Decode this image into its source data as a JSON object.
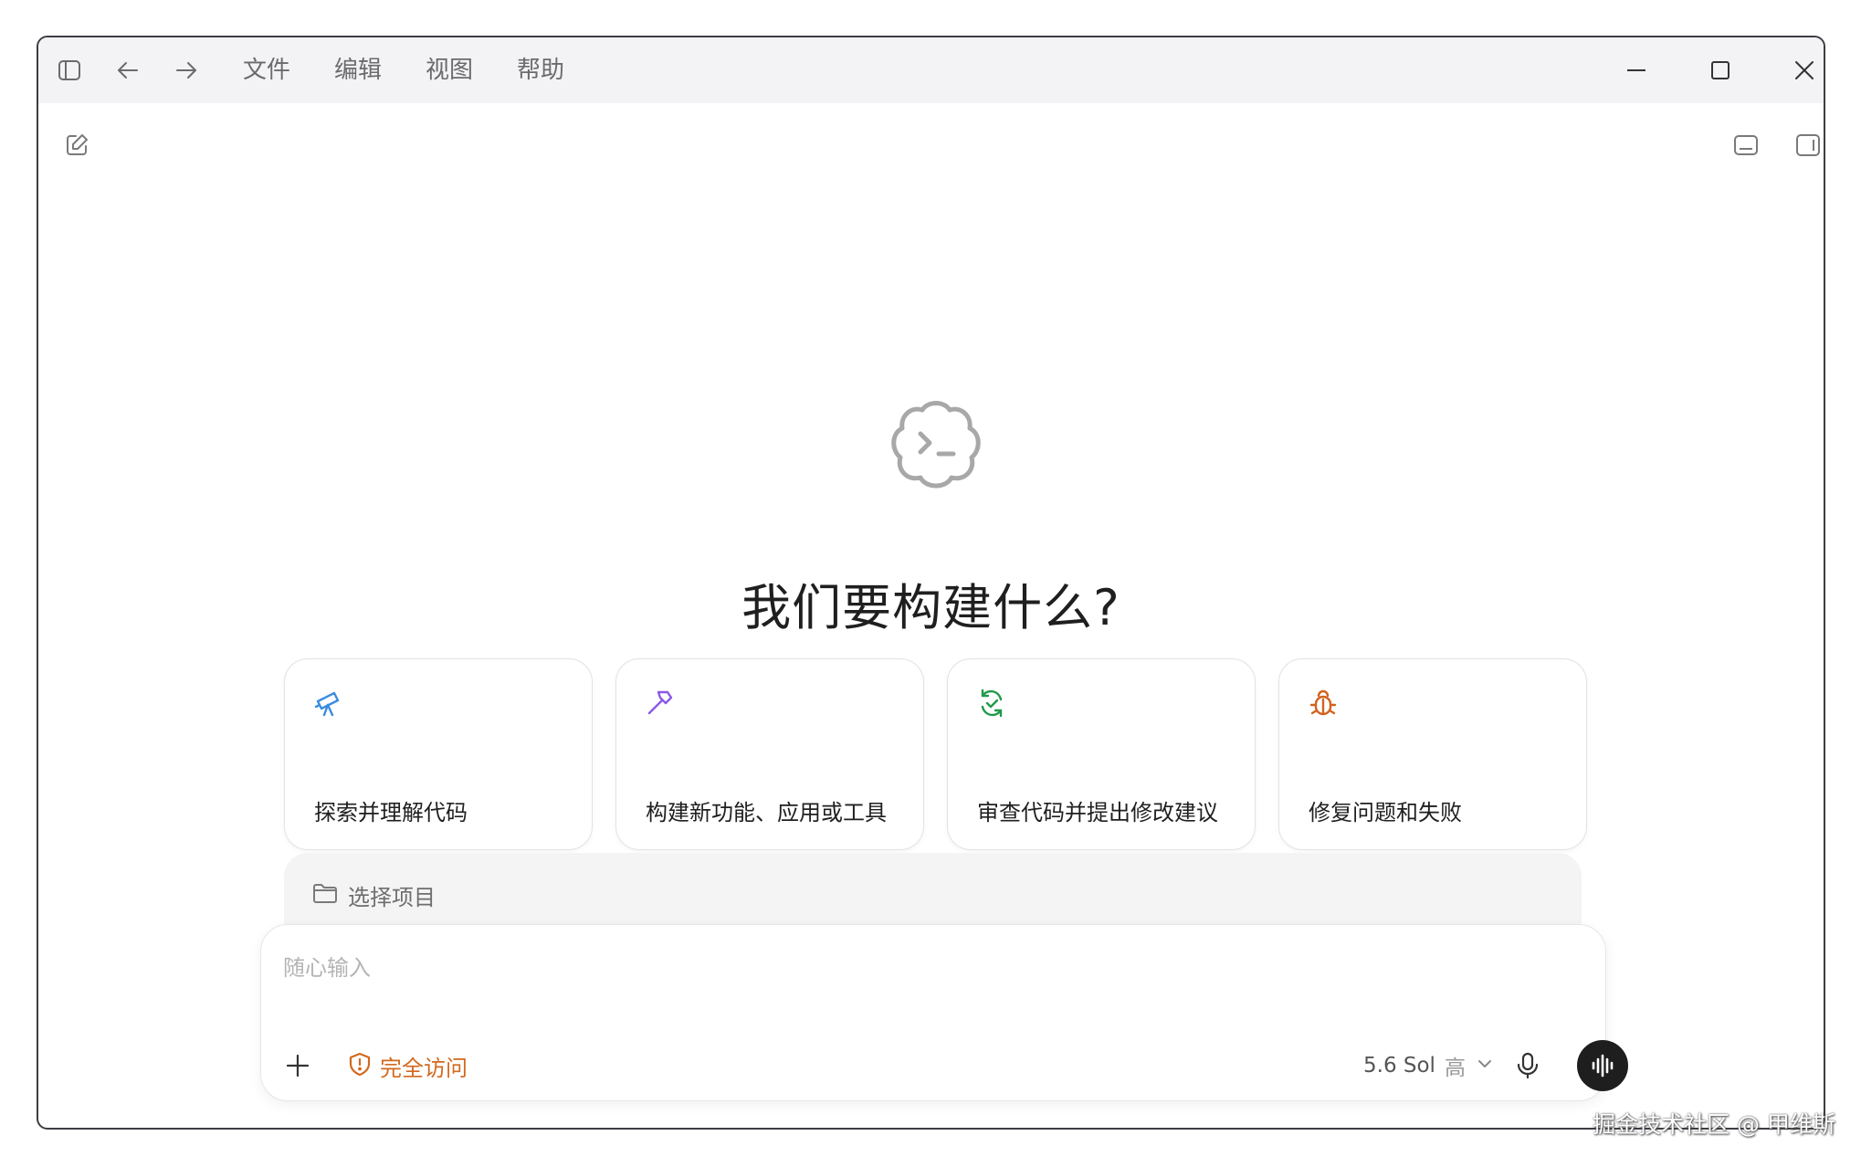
{
  "menu": {
    "items": [
      "文件",
      "编辑",
      "视图",
      "帮助"
    ]
  },
  "hero": {
    "heading": "我们要构建什么?"
  },
  "cards": [
    {
      "label": "探索并理解代码",
      "icon": "telescope-icon",
      "color": "#3a8de0"
    },
    {
      "label": "构建新功能、应用或工具",
      "icon": "hammer-icon",
      "color": "#8a5ae6"
    },
    {
      "label": "审查代码并提出修改建议",
      "icon": "refresh-check-icon",
      "color": "#1f9a4a"
    },
    {
      "label": "修复问题和失败",
      "icon": "bug-icon",
      "color": "#d2621e"
    }
  ],
  "project": {
    "label": "选择项目"
  },
  "composer": {
    "placeholder": "随心输入",
    "access_label": "完全访问",
    "model_label": "5.6 Sol",
    "effort_label": "高"
  },
  "watermark": "掘金技术社区 @ 甲维斯",
  "colors": {
    "access": "#d2691e",
    "titlebar": "#f3f3f6",
    "voice_button": "#1e1e1e"
  }
}
